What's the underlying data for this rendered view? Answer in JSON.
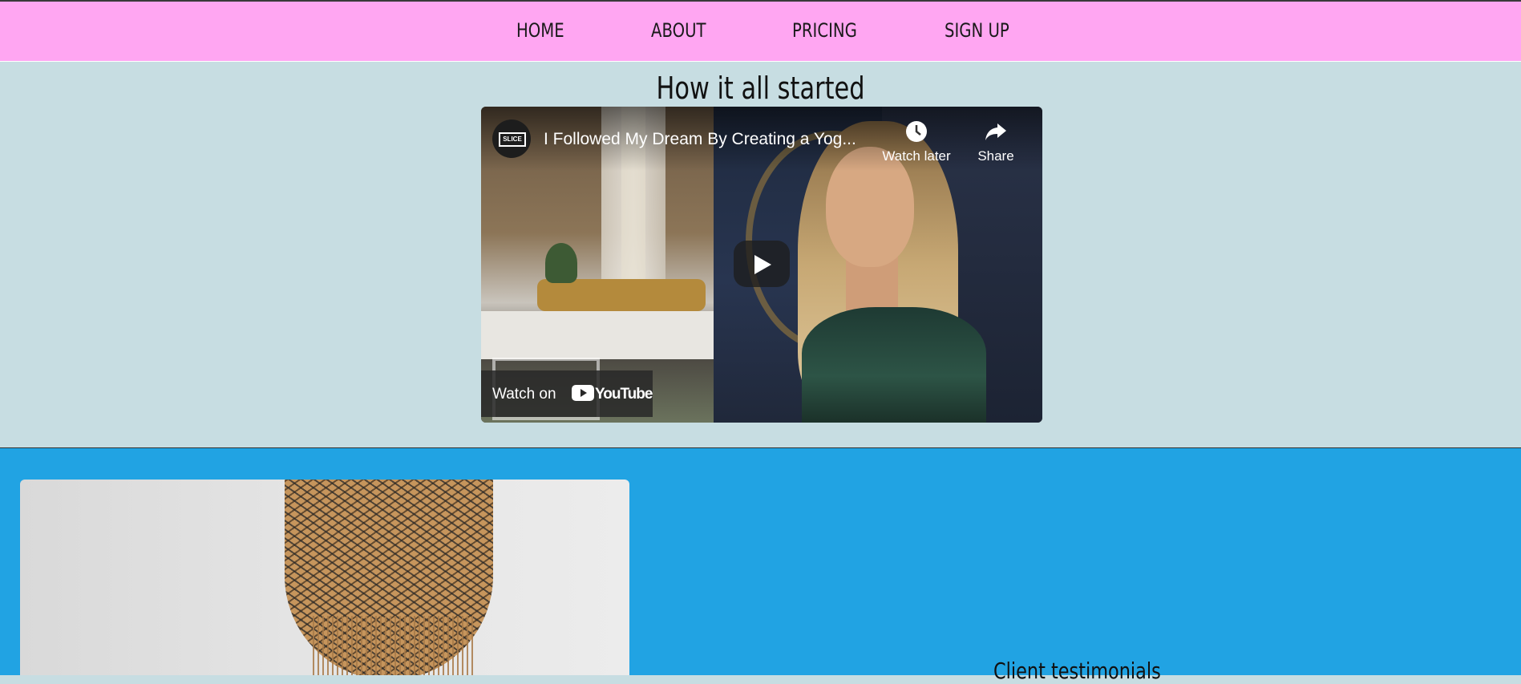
{
  "nav": {
    "items": [
      {
        "label": "HOME"
      },
      {
        "label": "ABOUT"
      },
      {
        "label": "PRICING"
      },
      {
        "label": "SIGN UP"
      }
    ]
  },
  "video_section": {
    "heading": "How it all started",
    "video": {
      "channel_logo_text": "SLICE",
      "title": "I Followed My Dream By Creating a Yog...",
      "watch_later_label": "Watch later",
      "share_label": "Share",
      "watch_on_label": "Watch on",
      "youtube_label": "YouTube",
      "watermark_text": "SLICE"
    }
  },
  "testimonials": {
    "heading": "Client testimonials"
  },
  "colors": {
    "nav_bg": "#ffa6f2",
    "video_section_bg": "#c7dde2",
    "testimonials_bg": "#21a3e3"
  }
}
